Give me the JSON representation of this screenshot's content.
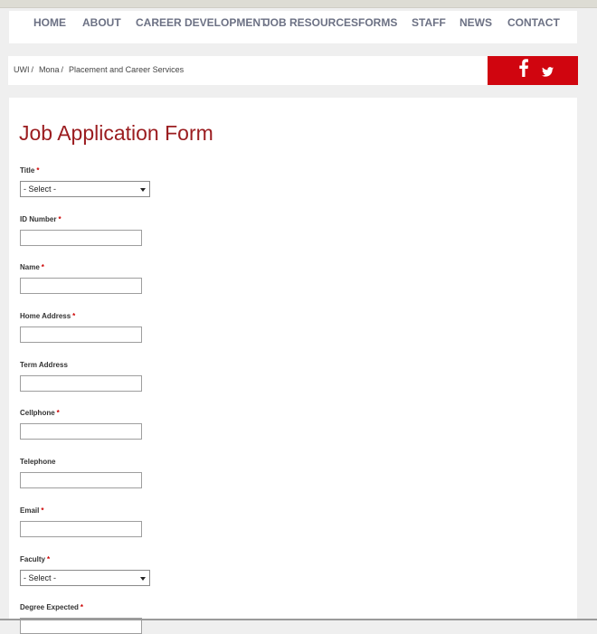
{
  "nav": {
    "items": [
      "HOME",
      "ABOUT",
      "CAREER DEVELOPMENT",
      "JOB RESOURCES",
      "FORMS",
      "STAFF",
      "NEWS",
      "CONTACT"
    ]
  },
  "breadcrumb": [
    "UWI",
    "Mona",
    "Placement and Career Services"
  ],
  "breadcrumb_separator": "/",
  "social": {
    "icons": [
      "facebook-icon",
      "twitter-icon"
    ],
    "bg_color": "#d0050f"
  },
  "form": {
    "title": "Job Application Form",
    "required_marker": "*",
    "fields": [
      {
        "label": "Title",
        "required": true,
        "type": "select",
        "value": "- Select -"
      },
      {
        "label": "ID Number",
        "required": true,
        "type": "text",
        "value": ""
      },
      {
        "label": "Name",
        "required": true,
        "type": "text",
        "value": ""
      },
      {
        "label": "Home Address",
        "required": true,
        "type": "text",
        "value": ""
      },
      {
        "label": "Term Address",
        "required": false,
        "type": "text",
        "value": ""
      },
      {
        "label": "Cellphone",
        "required": true,
        "type": "text",
        "value": ""
      },
      {
        "label": "Telephone",
        "required": false,
        "type": "text",
        "value": ""
      },
      {
        "label": "Email",
        "required": true,
        "type": "text",
        "value": ""
      },
      {
        "label": "Faculty",
        "required": true,
        "type": "select",
        "value": "- Select -"
      },
      {
        "label": "Degree Expected",
        "required": true,
        "type": "text",
        "value": ""
      }
    ]
  },
  "colors": {
    "title": "#9b1d20",
    "nav_text": "#6c7184",
    "accent": "#d0050f"
  }
}
